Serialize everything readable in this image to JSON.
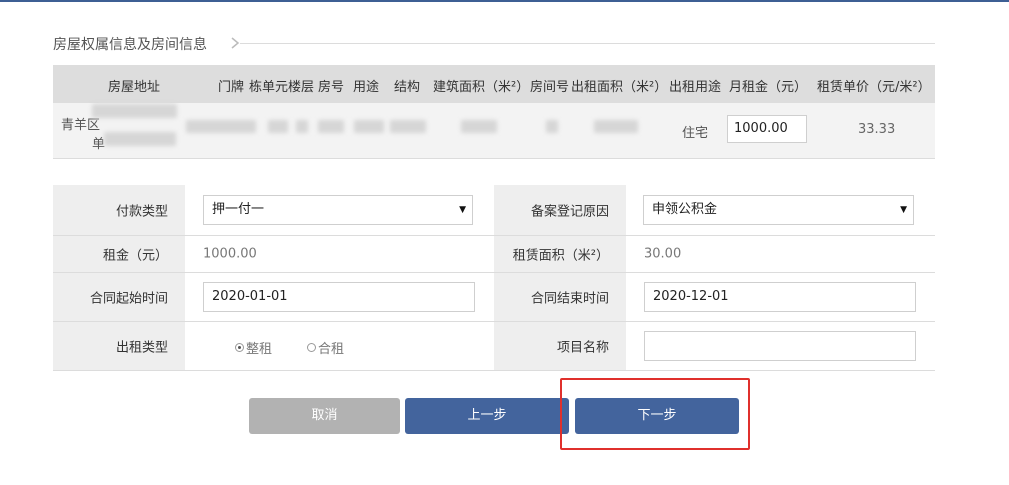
{
  "section": {
    "title": "房屋权属信息及房间信息"
  },
  "table": {
    "headers": [
      "房屋地址",
      "门牌",
      "栋单元楼层",
      "房号",
      "用途",
      "结构",
      "建筑面积（米²）",
      "房间号",
      "出租面积（米²）",
      "出租用途",
      "月租金（元）",
      "租赁单价（元/米²）"
    ],
    "row": {
      "address_line1": "青羊区",
      "address_line2": "单",
      "usage": "住宅",
      "monthly_rent": "1000.00",
      "unit_price": "33.33"
    }
  },
  "form": {
    "payment_type": {
      "label": "付款类型",
      "value": "押一付一"
    },
    "filing_reason": {
      "label": "备案登记原因",
      "value": "申领公积金"
    },
    "rent": {
      "label": "租金（元）",
      "value": "1000.00"
    },
    "lease_area": {
      "label": "租赁面积（米²）",
      "value": "30.00"
    },
    "start_date": {
      "label": "合同起始时间",
      "value": "2020-01-01"
    },
    "end_date": {
      "label": "合同结束时间",
      "value": "2020-12-01"
    },
    "rental_type": {
      "label": "出租类型",
      "options": [
        "整租",
        "合租"
      ],
      "selected": "整租"
    },
    "project_name": {
      "label": "项目名称",
      "value": ""
    }
  },
  "buttons": {
    "cancel": "取消",
    "prev": "上一步",
    "next": "下一步"
  },
  "colors": {
    "primary": "#43649d",
    "cancel": "#b2b2b2",
    "highlight": "#e0302c",
    "header_bg": "#dddddd"
  }
}
